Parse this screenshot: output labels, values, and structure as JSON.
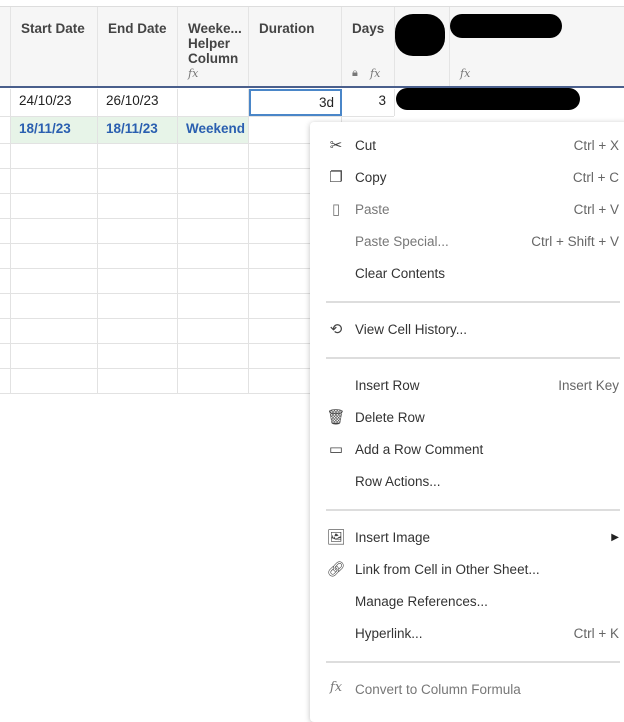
{
  "columns": [
    {
      "label": "Start Date"
    },
    {
      "label": "End Date"
    },
    {
      "label": "Weeke...\nHelper\nColumn",
      "formula": true
    },
    {
      "label": "Duration"
    },
    {
      "label": "Days",
      "locked": true,
      "formula": true
    },
    {
      "label": "",
      "redacted": true
    },
    {
      "label": "",
      "redacted": true,
      "formula": true
    }
  ],
  "rows": [
    {
      "start": "24/10/23",
      "end": "26/10/23",
      "weekend": "",
      "duration": "3d",
      "days": "3"
    },
    {
      "start": "18/11/23",
      "end": "18/11/23",
      "weekend": "Weekend",
      "duration": "",
      "days": ""
    }
  ],
  "colors": {
    "accent": "#4a86c8",
    "highlight_row": "#e7f4e8",
    "highlight_text": "#2a5fb0"
  },
  "menu": {
    "items": [
      {
        "label": "Cut",
        "shortcut": "Ctrl + X",
        "icon": "scissors-icon"
      },
      {
        "label": "Copy",
        "shortcut": "Ctrl + C",
        "icon": "copy-icon"
      },
      {
        "label": "Paste",
        "shortcut": "Ctrl + V",
        "icon": "clipboard-icon",
        "disabled": true
      },
      {
        "label": "Paste Special...",
        "shortcut": "Ctrl + Shift + V",
        "disabled": true
      },
      {
        "label": "Clear Contents"
      },
      {
        "label": "View Cell History...",
        "icon": "history-icon"
      },
      {
        "label": "Insert Row",
        "shortcut": "Insert Key"
      },
      {
        "label": "Delete Row",
        "icon": "trash-icon"
      },
      {
        "label": "Add a Row Comment",
        "icon": "comment-icon"
      },
      {
        "label": "Row Actions..."
      },
      {
        "label": "Insert Image",
        "icon": "image-icon",
        "submenu": true
      },
      {
        "label": "Link from Cell in Other Sheet...",
        "icon": "link-icon"
      },
      {
        "label": "Manage References..."
      },
      {
        "label": "Hyperlink...",
        "shortcut": "Ctrl + K"
      },
      {
        "label": "Convert to Column Formula",
        "icon": "fx-icon",
        "disabled": true
      }
    ]
  }
}
